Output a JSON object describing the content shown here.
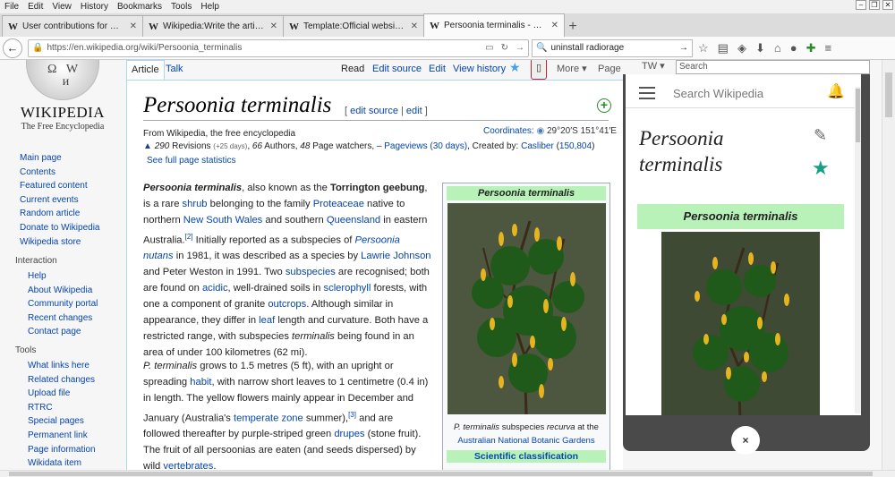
{
  "menubar": [
    "File",
    "Edit",
    "View",
    "History",
    "Bookmarks",
    "Tools",
    "Help"
  ],
  "tabs": [
    {
      "title": "User contributions for Che...",
      "active": false
    },
    {
      "title": "Wikipedia:Write the article ...",
      "active": false
    },
    {
      "title": "Template:Official website/...",
      "active": false
    },
    {
      "title": "Persoonia terminalis - Wiki...",
      "active": true
    }
  ],
  "nav": {
    "url": "https://en.wikipedia.org/wiki/Persoonia_terminalis",
    "search_value": "uninstall radiorage"
  },
  "sidebar": {
    "wordmark": "WIKIPEDIA",
    "tagline": "The Free Encyclopedia",
    "main_links": [
      "Main page",
      "Contents",
      "Featured content",
      "Current events",
      "Random article",
      "Donate to Wikipedia",
      "Wikipedia store"
    ],
    "interaction_header": "Interaction",
    "interaction_links": [
      "Help",
      "About Wikipedia",
      "Community portal",
      "Recent changes",
      "Contact page"
    ],
    "tools_header": "Tools",
    "tools_links": [
      "What links here",
      "Related changes",
      "Upload file",
      "RTRC",
      "Special pages",
      "Permanent link",
      "Page information",
      "Wikidata item"
    ]
  },
  "pagetabs": {
    "article": "Article",
    "talk": "Talk",
    "read": "Read",
    "edit_source": "Edit source",
    "edit": "Edit",
    "history": "View history",
    "more": "More",
    "page": "Page",
    "tw": "TW",
    "search_placeholder": "Search"
  },
  "article": {
    "title": "Persoonia terminalis",
    "edit_source": "edit source",
    "edit": "edit",
    "from": "From Wikipedia, the free encyclopedia",
    "coords_label": "Coordinates:",
    "coords_value": "29°20′S 151°41′E",
    "revisions": "290",
    "revisions_label": "Revisions",
    "revisions_days": "(+25 days)",
    "authors": "66",
    "authors_label": "Authors,",
    "watchers": "48",
    "watchers_label": "Page watchers, –",
    "pageviews": "Pageviews (30 days)",
    "created_by": ", Created by:",
    "creator": "Casliber",
    "creator_edits": "150,804",
    "full_stats": "See full page statistics"
  },
  "infobox": {
    "title": "Persoonia terminalis",
    "caption_italic": "P. terminalis",
    "caption_mid": " subspecies ",
    "caption_sub": "recurva",
    "caption_end": " at the",
    "caption_link": "Australian National Botanic Gardens",
    "sci_class": "Scientific classification"
  },
  "mobile": {
    "search_placeholder": "Search Wikipedia",
    "title": "Persoonia terminalis",
    "infobox_title": "Persoonia terminalis",
    "close": "×"
  },
  "colors": {
    "link": "#0645ad",
    "infobox_green": "#b8f2b8",
    "highlight": "#c3232d",
    "star": "#16a085"
  }
}
